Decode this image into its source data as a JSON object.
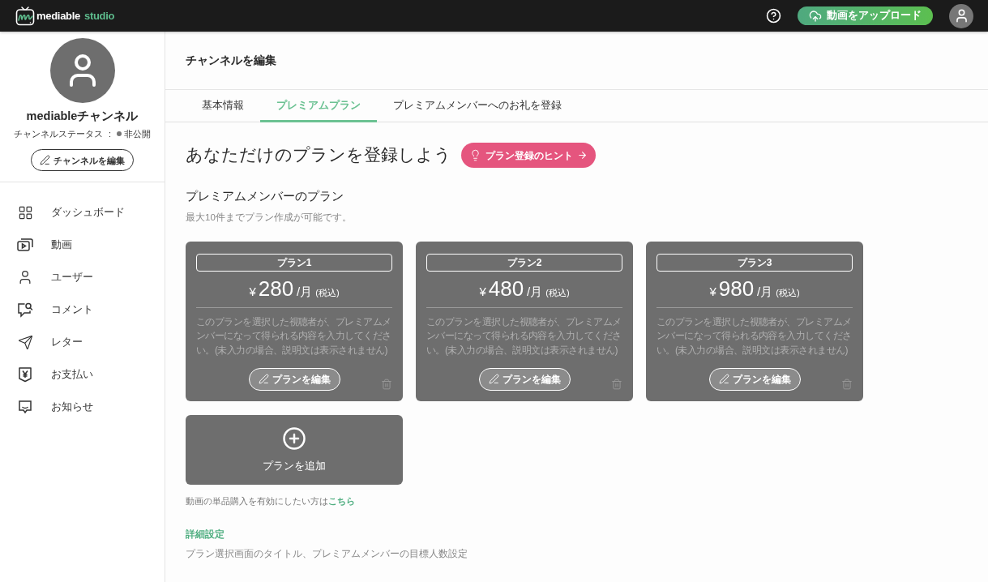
{
  "app_bar": {
    "logo": {
      "name": "mediable",
      "suffix": "studio"
    },
    "upload_button": "動画をアップロード"
  },
  "sidebar": {
    "channel_name": "mediableチャンネル",
    "status_label": "チャンネルステータス",
    "status_separator": ":",
    "status": "非公開",
    "edit_button": "チャンネルを編集",
    "nav": [
      {
        "label": "ダッシュボード",
        "selected": false
      },
      {
        "label": "動画",
        "selected": false
      },
      {
        "label": "ユーザー",
        "selected": false
      },
      {
        "label": "コメント",
        "selected": false
      },
      {
        "label": "レター",
        "selected": false
      },
      {
        "label": "お支払い",
        "selected": false
      },
      {
        "label": "お知らせ",
        "selected": false
      }
    ]
  },
  "header": {
    "title": "チャンネルを編集"
  },
  "tabs": [
    {
      "label": "基本情報",
      "selected": false
    },
    {
      "label": "プレミアムプラン",
      "selected": true
    },
    {
      "label": "プレミアムメンバーへのお礼を登録",
      "selected": false
    }
  ],
  "intro": {
    "heading": "あなただけのプランを登録しよう",
    "hint_button": "プラン登録のヒント"
  },
  "plans_section": {
    "title": "プレミアムメンバーのプラン",
    "note": "最大10件までプラン作成が可能です。",
    "plans": [
      {
        "name": "プラン1",
        "currency": "¥",
        "price": "280",
        "unit": "/月",
        "tax": "(税込)",
        "description": "このプランを選択した視聴者が、プレミアムメンバーになって得られる内容を入力してください。(未入力の場合、説明文は表示されません)",
        "edit_button": "プランを編集"
      },
      {
        "name": "プラン2",
        "currency": "¥",
        "price": "480",
        "unit": "/月",
        "tax": "(税込)",
        "description": "このプランを選択した視聴者が、プレミアムメンバーになって得られる内容を入力してください。(未入力の場合、説明文は表示されません)",
        "edit_button": "プランを編集"
      },
      {
        "name": "プラン3",
        "currency": "¥",
        "price": "980",
        "unit": "/月",
        "tax": "(税込)",
        "description": "このプランを選択した視聴者が、プレミアムメンバーになって得られる内容を入力してください。(未入力の場合、説明文は表示されません)",
        "edit_button": "プランを編集"
      }
    ],
    "add_button": "プランを追加"
  },
  "purchase_note": {
    "text": "動画の単品購入を有効にしたい方は",
    "link": "こちら"
  },
  "advanced": {
    "title": "詳細設定",
    "description": "プラン選択画面のタイトル、プレミアムメンバーの目標人数設定"
  }
}
